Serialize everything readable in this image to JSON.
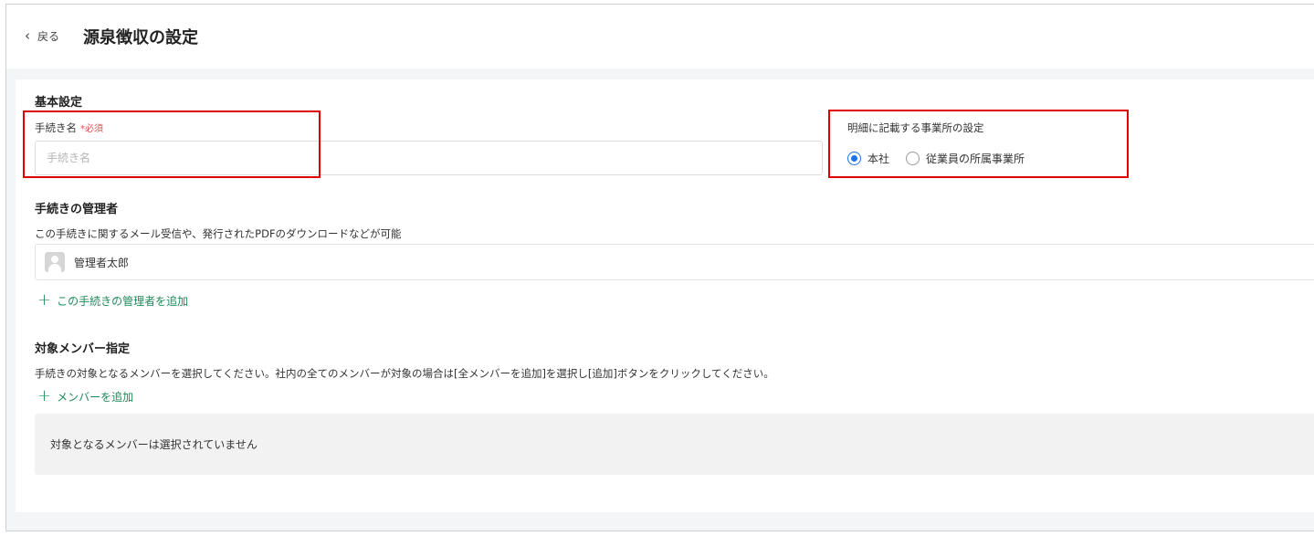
{
  "header": {
    "back_label": "戻る",
    "title": "源泉徴収の設定"
  },
  "basic": {
    "section_title": "基本設定",
    "name_label": "手続き名",
    "required_label": "*必須",
    "name_placeholder": "手続き名",
    "name_value": ""
  },
  "office": {
    "label": "明細に記載する事業所の設定",
    "options": [
      {
        "label": "本社",
        "checked": true
      },
      {
        "label": "従業員の所属事業所",
        "checked": false
      }
    ]
  },
  "admins": {
    "section_title": "手続きの管理者",
    "description": "この手続きに関するメール受信や、発行されたPDFのダウンロードなどが可能",
    "items": [
      {
        "name": "管理者太郎"
      }
    ],
    "add_label": "この手続きの管理者を追加"
  },
  "members": {
    "section_title": "対象メンバー指定",
    "description": "手続きの対象となるメンバーを選択してください。社内の全てのメンバーが対象の場合は[全メンバーを追加]を選択し[追加]ボタンをクリックしてください。",
    "add_label": "メンバーを追加",
    "empty_text": "対象となるメンバーは選択されていません"
  },
  "colors": {
    "accent_green": "#1e8a5a",
    "radio_blue": "#1a73e8",
    "highlight_red": "#e10000",
    "required_red": "#d9534f"
  },
  "icons": {
    "back": "chevron-left-icon",
    "plus": "plus-icon",
    "avatar": "user-avatar-icon"
  }
}
